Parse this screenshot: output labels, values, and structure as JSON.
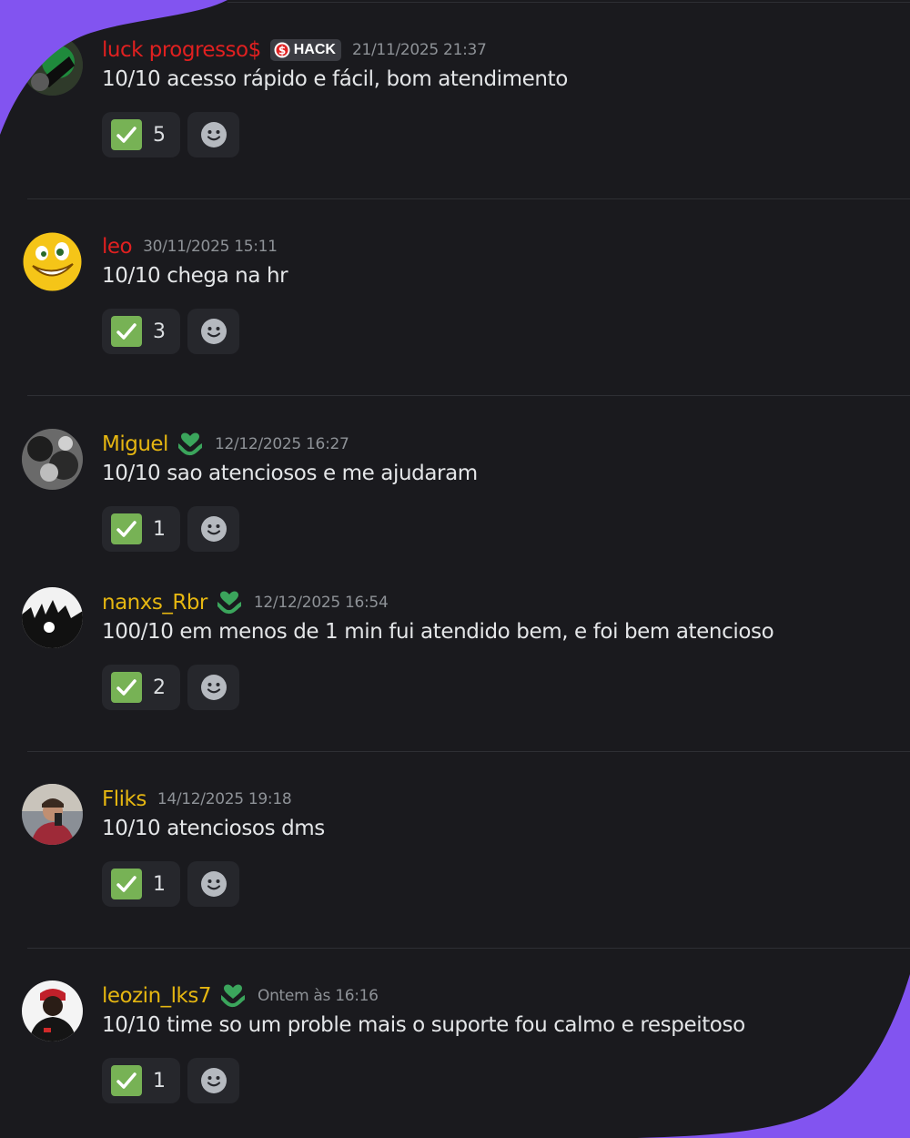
{
  "colors": {
    "background": "#1a1a1e",
    "accent_purple": "#8254f0",
    "username_red": "#e02020",
    "username_gold": "#e5b611",
    "timestamp_gray": "#8e9297",
    "role_icon_green": "#3ba55c",
    "check_green": "#77b255"
  },
  "messages": [
    {
      "username": "luck progresso$",
      "name_color": "red",
      "tag": "HACK",
      "timestamp": "21/11/2025 21:37",
      "content": "10/10 acesso rápido e fácil, bom atendimento",
      "reaction_count": "5",
      "reaction_icon": "check-mark-button-icon",
      "role_icon": ""
    },
    {
      "username": "leo",
      "name_color": "red",
      "tag": "",
      "timestamp": "30/11/2025 15:11",
      "content": "10/10 chega na hr",
      "reaction_count": "3",
      "reaction_icon": "check-mark-button-icon",
      "role_icon": ""
    },
    {
      "username": "Miguel",
      "name_color": "gold",
      "tag": "",
      "timestamp": "12/12/2025 16:27",
      "content": "10/10 sao atenciosos e me ajudaram",
      "reaction_count": "1",
      "reaction_icon": "check-mark-button-icon",
      "role_icon": "green-heart-hands-icon"
    },
    {
      "username": "nanxs_Rbr",
      "name_color": "gold",
      "tag": "",
      "timestamp": "12/12/2025 16:54",
      "content": "100/10 em menos de 1 min fui atendido bem, e foi bem atencioso",
      "reaction_count": "2",
      "reaction_icon": "check-mark-button-icon",
      "role_icon": "green-heart-hands-icon"
    },
    {
      "username": "Fliks",
      "name_color": "gold",
      "tag": "",
      "timestamp": "14/12/2025 19:18",
      "content": "10/10 atenciosos dms",
      "reaction_count": "1",
      "reaction_icon": "check-mark-button-icon",
      "role_icon": ""
    },
    {
      "username": "leozin_lks7",
      "name_color": "gold",
      "tag": "",
      "timestamp": "Ontem às 16:16",
      "content": "10/10 time so um proble mais o suporte fou calmo e respeitoso",
      "reaction_count": "1",
      "reaction_icon": "check-mark-button-icon",
      "role_icon": "green-heart-hands-icon"
    }
  ]
}
